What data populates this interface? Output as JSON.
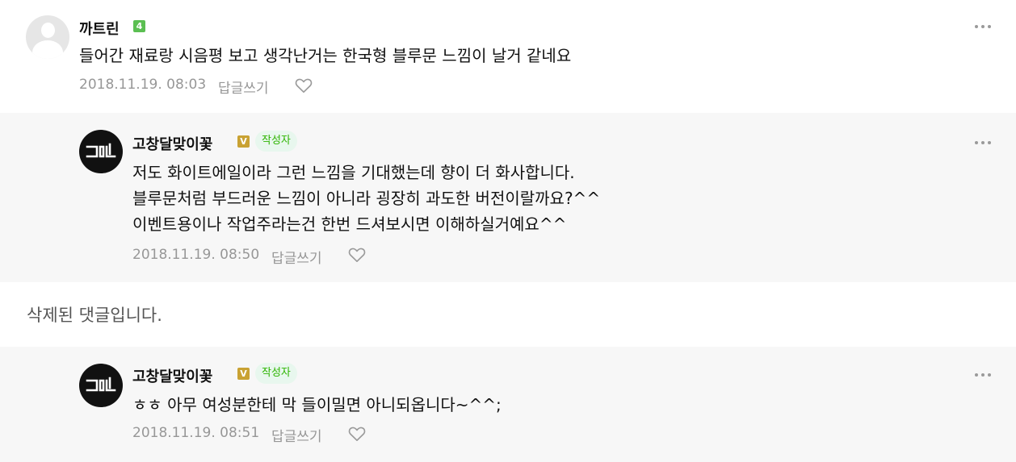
{
  "comments": [
    {
      "nickname": "까트린",
      "grade": "4",
      "text_lines": [
        "들어간 재료랑 시음평 보고 생각난거는 한국형 블루문 느낌이 날거 같네요"
      ],
      "date": "2018.11.19. 08:03",
      "reply_label": "답글쓰기",
      "avatar": "default-avatar",
      "heart_icon": "heart-outline-icon"
    }
  ],
  "replies": [
    {
      "nickname": "고창달맞이꽃",
      "grade": "V",
      "author_badge": "작성자",
      "text_lines": [
        "저도 화이트에일이라 그런 느낌을 기대했는데 향이 더 화사합니다.",
        "블루문처럼 부드러운 느낌이 아니라 굉장히 과도한 버전이랄까요?^^",
        "이벤트용이나 작업주라는건 한번 드셔보시면 이해하실거예요^^"
      ],
      "date": "2018.11.19. 08:50",
      "reply_label": "답글쓰기"
    },
    {
      "nickname": "고창달맞이꽃",
      "grade": "V",
      "author_badge": "작성자",
      "text_lines": [
        "ㅎㅎ 아무 여성분한테 막 들이밀면 아니되옵니다~^^;"
      ],
      "date": "2018.11.19. 08:51",
      "reply_label": "답글쓰기"
    }
  ],
  "deleted_text": "삭제된 댓글입니다.",
  "colors": {
    "reply_bg": "#f7f7f7",
    "badge_text": "#2db400",
    "badge_bg": "#e8f7ee",
    "meta_text": "#979797"
  }
}
